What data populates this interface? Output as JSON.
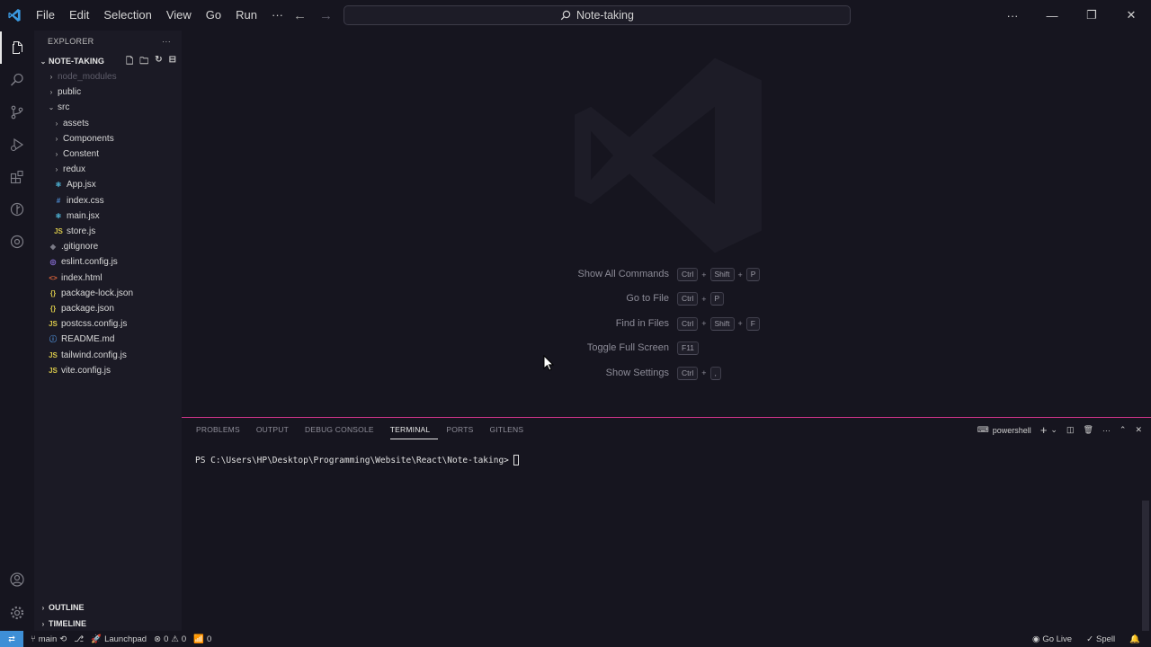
{
  "title_bar": {
    "menu": [
      "File",
      "Edit",
      "Selection",
      "View",
      "Go",
      "Run",
      "···"
    ],
    "command_center": "Note-taking",
    "more_label": "···"
  },
  "explorer": {
    "header": "EXPLORER",
    "more": "···",
    "project": "NOTE-TAKING",
    "items": [
      {
        "name": "node_modules",
        "type": "folder",
        "open": false,
        "depth": 1,
        "dim": true
      },
      {
        "name": "public",
        "type": "folder",
        "open": false,
        "depth": 1
      },
      {
        "name": "src",
        "type": "folder",
        "open": true,
        "depth": 1
      },
      {
        "name": "assets",
        "type": "folder",
        "open": false,
        "depth": 2
      },
      {
        "name": "Components",
        "type": "folder",
        "open": false,
        "depth": 2
      },
      {
        "name": "Constent",
        "type": "folder",
        "open": false,
        "depth": 2
      },
      {
        "name": "redux",
        "type": "folder",
        "open": false,
        "depth": 2
      },
      {
        "name": "App.jsx",
        "type": "file",
        "icon": "react",
        "depth": 2
      },
      {
        "name": "index.css",
        "type": "file",
        "icon": "css",
        "depth": 2
      },
      {
        "name": "main.jsx",
        "type": "file",
        "icon": "react",
        "depth": 2
      },
      {
        "name": "store.js",
        "type": "file",
        "icon": "js",
        "depth": 2
      },
      {
        "name": ".gitignore",
        "type": "file",
        "icon": "git",
        "depth": 1
      },
      {
        "name": "eslint.config.js",
        "type": "file",
        "icon": "eslint",
        "depth": 1
      },
      {
        "name": "index.html",
        "type": "file",
        "icon": "html",
        "depth": 1
      },
      {
        "name": "package-lock.json",
        "type": "file",
        "icon": "json",
        "depth": 1
      },
      {
        "name": "package.json",
        "type": "file",
        "icon": "json",
        "depth": 1
      },
      {
        "name": "postcss.config.js",
        "type": "file",
        "icon": "js",
        "depth": 1
      },
      {
        "name": "README.md",
        "type": "file",
        "icon": "info",
        "depth": 1
      },
      {
        "name": "tailwind.config.js",
        "type": "file",
        "icon": "js",
        "depth": 1
      },
      {
        "name": "vite.config.js",
        "type": "file",
        "icon": "js",
        "depth": 1
      }
    ],
    "outline": "OUTLINE",
    "timeline": "TIMELINE"
  },
  "editor": {
    "shortcuts": [
      {
        "label": "Show All Commands",
        "keys": [
          "Ctrl",
          "Shift",
          "P"
        ]
      },
      {
        "label": "Go to File",
        "keys": [
          "Ctrl",
          "P"
        ]
      },
      {
        "label": "Find in Files",
        "keys": [
          "Ctrl",
          "Shift",
          "F"
        ]
      },
      {
        "label": "Toggle Full Screen",
        "keys": [
          "F11"
        ]
      },
      {
        "label": "Show Settings",
        "keys": [
          "Ctrl",
          ","
        ]
      }
    ]
  },
  "panel": {
    "tabs": [
      "PROBLEMS",
      "OUTPUT",
      "DEBUG CONSOLE",
      "TERMINAL",
      "PORTS",
      "GITLENS"
    ],
    "active_tab": "TERMINAL",
    "terminal_name": "powershell",
    "prompt": "PS C:\\Users\\HP\\Desktop\\Programming\\Website\\React\\Note-taking> "
  },
  "status_bar": {
    "branch": "main",
    "launchpad": "Launchpad",
    "errors": "0",
    "warnings": "0",
    "ports": "0",
    "go_live": "Go Live",
    "spell": "Spell"
  },
  "colors": {
    "background": "#16151f",
    "sidebar": "#1b1a25",
    "panel_border": "#d1348a",
    "remote": "#3e8fd6"
  }
}
